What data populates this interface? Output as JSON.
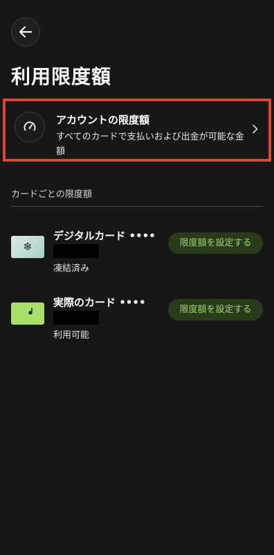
{
  "header": {
    "title": "利用限度額"
  },
  "account_limit": {
    "title": "アカウントの限度額",
    "description": "すべてのカードで支払いおよび出金が可能な金額"
  },
  "section": {
    "label": "カードごとの限度額"
  },
  "cards": [
    {
      "name": "デジタルカード ••••",
      "status": "凍結済み",
      "button_label": "限度額を設定する",
      "thumb_glyph": "❄"
    },
    {
      "name": "実際のカード ••••",
      "status": "利用可能",
      "button_label": "限度額を設定する",
      "thumb_glyph": "ᖱ"
    }
  ],
  "colors": {
    "background": "#171816",
    "highlight_border": "#e2452d",
    "button_bg": "#2a3a1c",
    "button_text": "#9fd869",
    "physical_card": "#a8e06a"
  },
  "icons": {
    "back": "arrow-left-icon",
    "account": "speedometer-icon",
    "chevron": "chevron-right-icon",
    "frozen": "snowflake-icon"
  }
}
